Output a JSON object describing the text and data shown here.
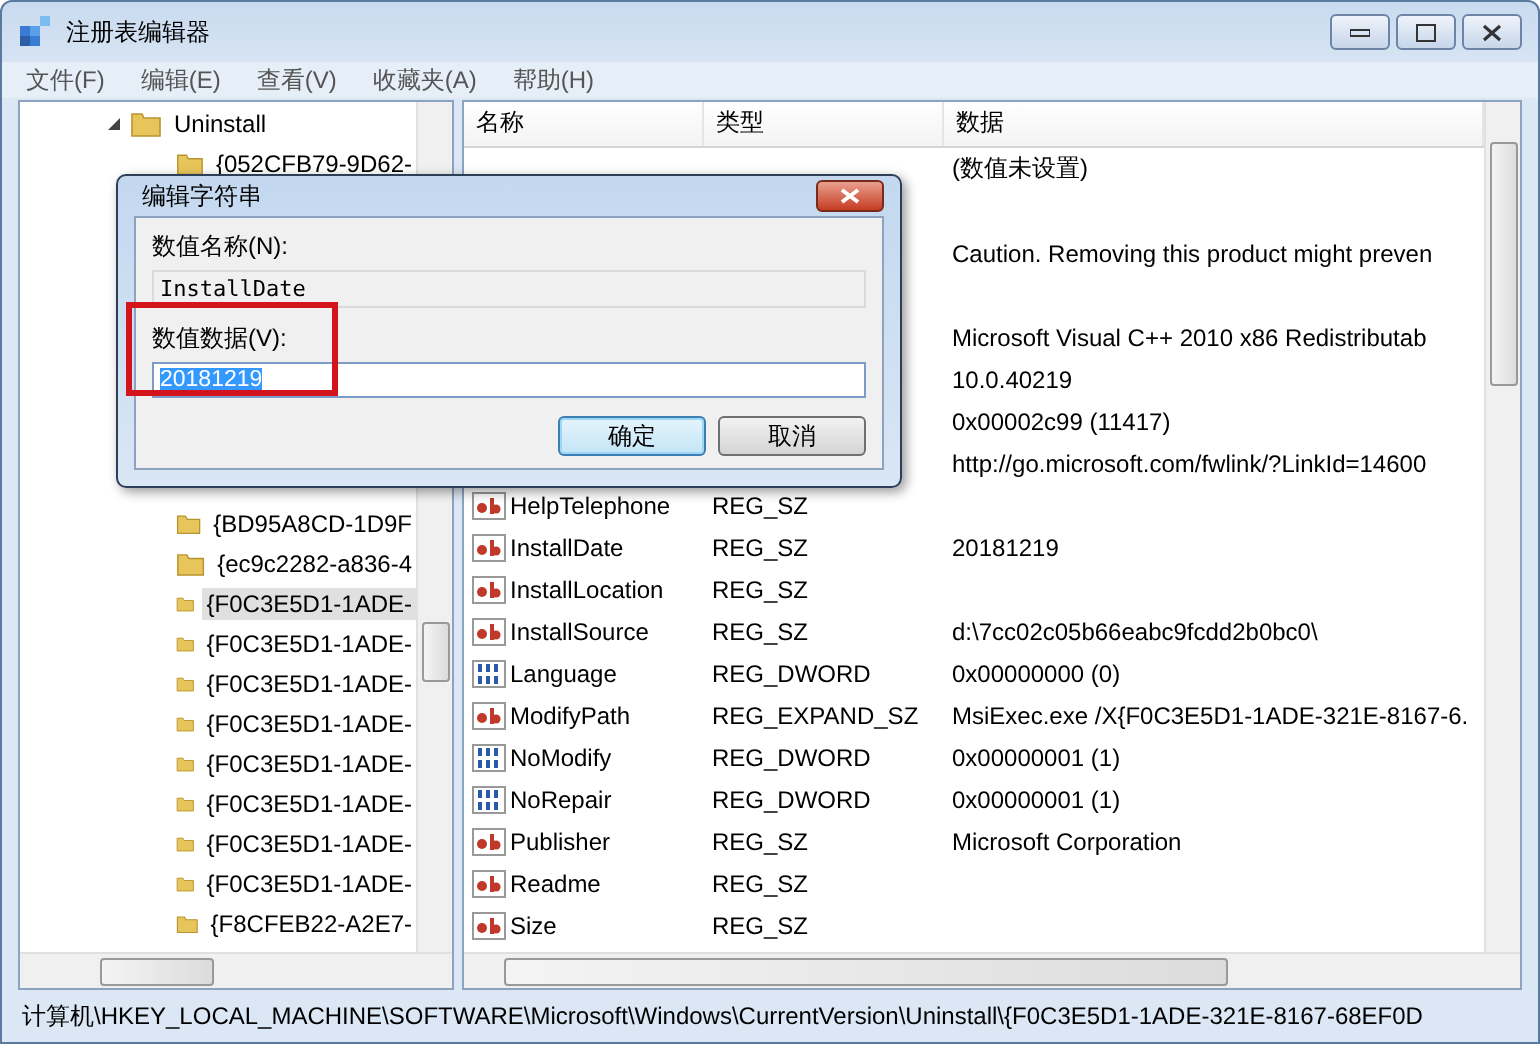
{
  "window": {
    "title": "注册表编辑器"
  },
  "menu": [
    "文件(F)",
    "编辑(E)",
    "查看(V)",
    "收藏夹(A)",
    "帮助(H)"
  ],
  "tree": {
    "label": "Uninstall",
    "expanded": true,
    "children": [
      {
        "label": "{052CFB79-9D62-",
        "selected": false
      },
      {
        "label": "{BD95A8CD-1D9F",
        "selected": false
      },
      {
        "label": "{ec9c2282-a836-4",
        "selected": false
      },
      {
        "label": "{F0C3E5D1-1ADE-",
        "selected": true
      },
      {
        "label": "{F0C3E5D1-1ADE-",
        "selected": false
      },
      {
        "label": "{F0C3E5D1-1ADE-",
        "selected": false
      },
      {
        "label": "{F0C3E5D1-1ADE-",
        "selected": false
      },
      {
        "label": "{F0C3E5D1-1ADE-",
        "selected": false
      },
      {
        "label": "{F0C3E5D1-1ADE-",
        "selected": false
      },
      {
        "label": "{F0C3E5D1-1ADE-",
        "selected": false
      },
      {
        "label": "{F0C3E5D1-1ADE-",
        "selected": false
      },
      {
        "label": "{F8CFEB22-A2E7-",
        "selected": false
      }
    ]
  },
  "values": {
    "columns": [
      "名称",
      "类型",
      "数据"
    ],
    "rows": [
      {
        "data": "(数值未设置)"
      },
      {
        "data": "Caution. Removing this product might preven"
      },
      {
        "data": "Microsoft Visual C++ 2010  x86 Redistributab"
      },
      {
        "data": "10.0.40219"
      },
      {
        "data": "0x00002c99 (11417)"
      },
      {
        "data": "http://go.microsoft.com/fwlink/?LinkId=14600"
      },
      {
        "kind": "string",
        "name": "HelpTelephone",
        "type": "REG_SZ"
      },
      {
        "kind": "string",
        "name": "InstallDate",
        "type": "REG_SZ",
        "data": "20181219"
      },
      {
        "kind": "string",
        "name": "InstallLocation",
        "type": "REG_SZ"
      },
      {
        "kind": "string",
        "name": "InstallSource",
        "type": "REG_SZ",
        "data": "d:\\7cc02c05b66eabc9fcdd2b0bc0\\"
      },
      {
        "kind": "dword",
        "name": "Language",
        "type": "REG_DWORD",
        "data": "0x00000000 (0)"
      },
      {
        "kind": "string",
        "name": "ModifyPath",
        "type": "REG_EXPAND_SZ",
        "data": "MsiExec.exe /X{F0C3E5D1-1ADE-321E-8167-6."
      },
      {
        "kind": "dword",
        "name": "NoModify",
        "type": "REG_DWORD",
        "data": "0x00000001 (1)"
      },
      {
        "kind": "dword",
        "name": "NoRepair",
        "type": "REG_DWORD",
        "data": "0x00000001 (1)"
      },
      {
        "kind": "string",
        "name": "Publisher",
        "type": "REG_SZ",
        "data": "Microsoft Corporation"
      },
      {
        "kind": "string",
        "name": "Readme",
        "type": "REG_SZ"
      },
      {
        "kind": "string",
        "name": "Size",
        "type": "REG_SZ"
      }
    ]
  },
  "status_bar": "计算机\\HKEY_LOCAL_MACHINE\\SOFTWARE\\Microsoft\\Windows\\CurrentVersion\\Uninstall\\{F0C3E5D1-1ADE-321E-8167-68EF0D",
  "dialog": {
    "title": "编辑字符串",
    "name_label": "数值名称(N):",
    "name_value": "InstallDate",
    "data_label": "数值数据(V):",
    "data_value": "20181219",
    "buttons": [
      {
        "label": "确定",
        "default": true
      },
      {
        "label": "取消",
        "default": false
      }
    ]
  }
}
